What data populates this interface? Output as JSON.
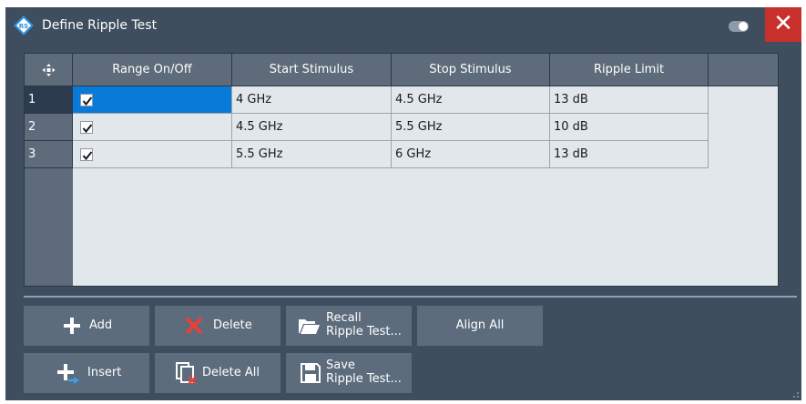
{
  "window": {
    "title": "Define Ripple Test"
  },
  "icons": {
    "logo": "rs-logo-icon",
    "toggle": "toggle-icon",
    "close": "close-icon",
    "corner": "grid-corner-icon"
  },
  "colors": {
    "background": "#3f4e5f",
    "close": "#c8302c",
    "selection": "#0a7ad8",
    "button": "#5c6c7d",
    "grid": "#e2e7ec"
  },
  "table": {
    "columns": [
      "Range On/Off",
      "Start Stimulus",
      "Stop Stimulus",
      "Ripple Limit"
    ],
    "rows": [
      {
        "num": "1",
        "checked": true,
        "start": "4 GHz",
        "stop": "4.5 GHz",
        "limit": "13 dB"
      },
      {
        "num": "2",
        "checked": true,
        "start": "4.5 GHz",
        "stop": "5.5 GHz",
        "limit": "10 dB"
      },
      {
        "num": "3",
        "checked": true,
        "start": "5.5 GHz",
        "stop": "6 GHz",
        "limit": "13 dB"
      }
    ]
  },
  "buttons": {
    "add": "Add",
    "delete": "Delete",
    "recall_line1": "Recall",
    "recall_line2": "Ripple Test...",
    "align_all": "Align All",
    "insert": "Insert",
    "delete_all": "Delete All",
    "save_line1": "Save",
    "save_line2": "Ripple Test..."
  }
}
